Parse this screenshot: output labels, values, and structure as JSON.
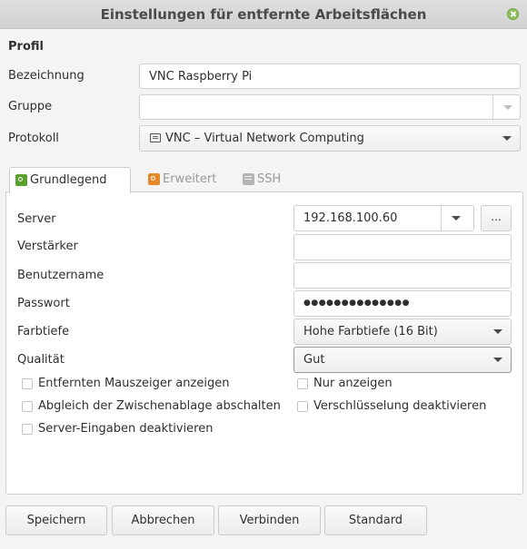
{
  "window": {
    "title": "Einstellungen für entfernte Arbeitsflächen"
  },
  "profile": {
    "section_title": "Profil",
    "name_label": "Bezeichnung",
    "name_value": "VNC Raspberry Pi",
    "group_label": "Gruppe",
    "group_value": "",
    "protocol_label": "Protokoll",
    "protocol_value": "VNC – Virtual Network Computing",
    "protocol_icon": "monitor-icon"
  },
  "tabs": [
    {
      "label": "Grundlegend",
      "icon": "basic-tab-icon",
      "active": true
    },
    {
      "label": "Erweitert",
      "icon": "advanced-tab-icon",
      "active": false
    },
    {
      "label": "SSH",
      "icon": "ssh-tab-icon",
      "active": false
    }
  ],
  "basic": {
    "server_label": "Server",
    "server_value": "192.168.100.60",
    "browse_label": "...",
    "repeater_label": "Verstärker",
    "repeater_value": "",
    "username_label": "Benutzername",
    "username_value": "",
    "password_label": "Passwort",
    "password_value": "●●●●●●●●●●●●●●",
    "colordepth_label": "Farbtiefe",
    "colordepth_value": "Hohe Farbtiefe (16 Bit)",
    "quality_label": "Qualität",
    "quality_value": "Gut",
    "checkboxes": {
      "show_cursor": "Entfernten Mauszeiger anzeigen",
      "view_only": "Nur anzeigen",
      "disable_clipboard": "Abgleich der Zwischenablage abschalten",
      "disable_encryption": "Verschlüsselung deaktivieren",
      "disable_server_input": "Server-Eingaben deaktivieren"
    }
  },
  "buttons": {
    "save": "Speichern",
    "cancel": "Abbrechen",
    "connect": "Verbinden",
    "default": "Standard"
  }
}
